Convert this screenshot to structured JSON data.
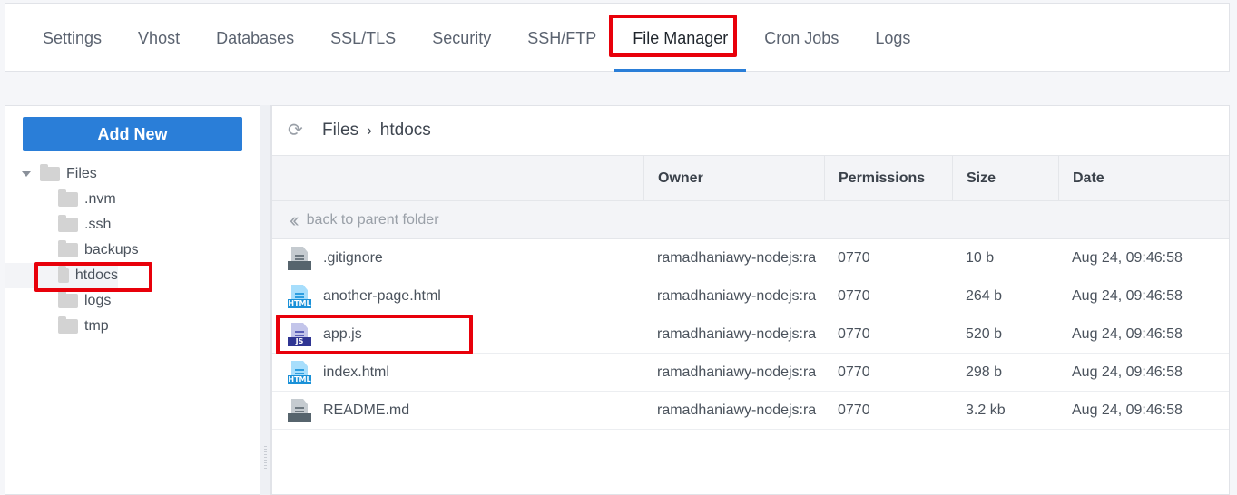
{
  "tabs": [
    {
      "label": "Settings",
      "active": false
    },
    {
      "label": "Vhost",
      "active": false
    },
    {
      "label": "Databases",
      "active": false
    },
    {
      "label": "SSL/TLS",
      "active": false
    },
    {
      "label": "Security",
      "active": false
    },
    {
      "label": "SSH/FTP",
      "active": false
    },
    {
      "label": "File Manager",
      "active": true
    },
    {
      "label": "Cron Jobs",
      "active": false
    },
    {
      "label": "Logs",
      "active": false
    }
  ],
  "sidebar": {
    "add_new_label": "Add New",
    "root": "Files",
    "folders": [
      ".nvm",
      ".ssh",
      "backups",
      "htdocs",
      "logs",
      "tmp"
    ],
    "selected_folder": "htdocs"
  },
  "breadcrumb": {
    "root": "Files",
    "separator": "›",
    "current": "htdocs"
  },
  "table": {
    "columns": [
      "",
      "Owner",
      "Permissions",
      "Size",
      "Date"
    ],
    "back_label": "back to parent folder",
    "rows": [
      {
        "name": ".gitignore",
        "icon": "text-file-icon",
        "type": "txt",
        "badge": "",
        "owner": "ramadhaniawy-nodejs:ra",
        "permissions": "0770",
        "size": "10 b",
        "date": "Aug 24, 09:46:58"
      },
      {
        "name": "another-page.html",
        "icon": "html-file-icon",
        "type": "html",
        "badge": "HTML",
        "owner": "ramadhaniawy-nodejs:ra",
        "permissions": "0770",
        "size": "264 b",
        "date": "Aug 24, 09:46:58"
      },
      {
        "name": "app.js",
        "icon": "js-file-icon",
        "type": "js",
        "badge": "JS",
        "owner": "ramadhaniawy-nodejs:ra",
        "permissions": "0770",
        "size": "520 b",
        "date": "Aug 24, 09:46:58"
      },
      {
        "name": "index.html",
        "icon": "html-file-icon",
        "type": "html",
        "badge": "HTML",
        "owner": "ramadhaniawy-nodejs:ra",
        "permissions": "0770",
        "size": "298 b",
        "date": "Aug 24, 09:46:58"
      },
      {
        "name": "README.md",
        "icon": "text-file-icon",
        "type": "txt",
        "badge": "",
        "owner": "ramadhaniawy-nodejs:ra",
        "permissions": "0770",
        "size": "3.2 kb",
        "date": "Aug 24, 09:46:58"
      }
    ]
  },
  "colors": {
    "accent": "#2a7ed8",
    "highlight": "#e8000a"
  }
}
